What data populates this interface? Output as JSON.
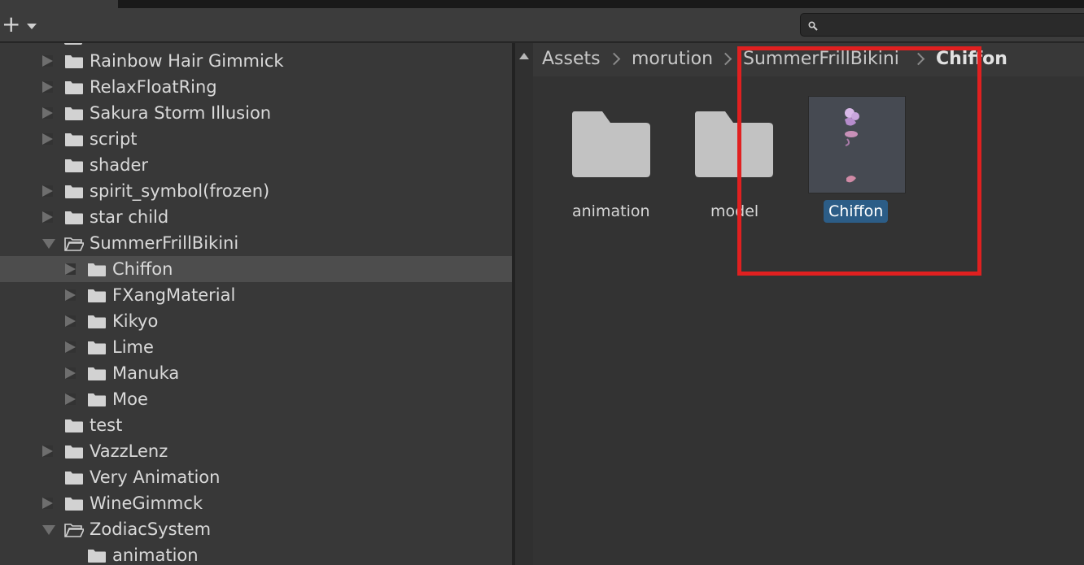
{
  "toolbar": {
    "add_label": "+",
    "search": {
      "value": "",
      "placeholder": ""
    }
  },
  "tree": {
    "items": [
      {
        "label": "Rainbow Hair Gimmick",
        "depth": 1,
        "state": "collapsed",
        "open_icon": false
      },
      {
        "label": "RelaxFloatRing",
        "depth": 1,
        "state": "collapsed",
        "open_icon": false
      },
      {
        "label": "Sakura Storm Illusion",
        "depth": 1,
        "state": "collapsed",
        "open_icon": false
      },
      {
        "label": "script",
        "depth": 1,
        "state": "collapsed",
        "open_icon": false
      },
      {
        "label": "shader",
        "depth": 1,
        "state": "none",
        "open_icon": false
      },
      {
        "label": "spirit_symbol(frozen)",
        "depth": 1,
        "state": "collapsed",
        "open_icon": false
      },
      {
        "label": "star child",
        "depth": 1,
        "state": "collapsed",
        "open_icon": false
      },
      {
        "label": "SummerFrillBikini",
        "depth": 1,
        "state": "expanded",
        "open_icon": true
      },
      {
        "label": "Chiffon",
        "depth": 2,
        "state": "collapsed",
        "open_icon": false,
        "selected": true
      },
      {
        "label": "FXangMaterial",
        "depth": 2,
        "state": "collapsed",
        "open_icon": false
      },
      {
        "label": "Kikyo",
        "depth": 2,
        "state": "collapsed",
        "open_icon": false
      },
      {
        "label": "Lime",
        "depth": 2,
        "state": "collapsed",
        "open_icon": false
      },
      {
        "label": "Manuka",
        "depth": 2,
        "state": "collapsed",
        "open_icon": false
      },
      {
        "label": "Moe",
        "depth": 2,
        "state": "collapsed",
        "open_icon": false
      },
      {
        "label": "test",
        "depth": 1,
        "state": "none",
        "open_icon": false
      },
      {
        "label": "VazzLenz",
        "depth": 1,
        "state": "collapsed",
        "open_icon": false
      },
      {
        "label": "Very Animation",
        "depth": 1,
        "state": "none",
        "open_icon": false
      },
      {
        "label": "WineGimmck",
        "depth": 1,
        "state": "collapsed",
        "open_icon": false
      },
      {
        "label": "ZodiacSystem",
        "depth": 1,
        "state": "expanded",
        "open_icon": true
      },
      {
        "label": "animation",
        "depth": 2,
        "state": "none",
        "open_icon": false
      }
    ]
  },
  "breadcrumb": [
    "Assets",
    "morution",
    "SummerFrillBikini",
    "Chiffon"
  ],
  "assets": [
    {
      "label": "animation",
      "kind": "folder"
    },
    {
      "label": "model",
      "kind": "folder"
    },
    {
      "label": "Chiffon",
      "kind": "prefab",
      "selected": true
    }
  ],
  "colors": {
    "selection": "#2c5d87",
    "highlight_box": "#e02020",
    "panel": "#383838",
    "folder": "#c2c2c2"
  },
  "icons": {
    "folder": "folder-icon",
    "folder_open": "folder-open-icon",
    "search": "search-icon",
    "expand": "triangle-right-icon",
    "collapse": "triangle-down-icon"
  }
}
